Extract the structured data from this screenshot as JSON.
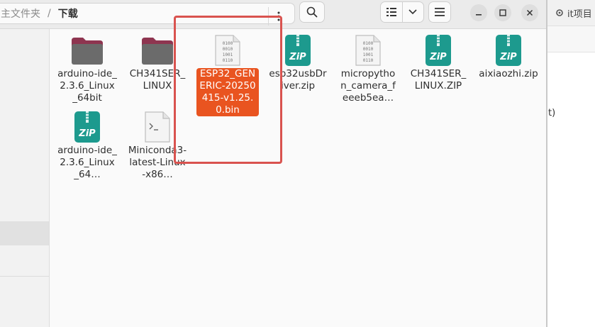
{
  "header": {
    "breadcrumb_parent": "主文件夹",
    "breadcrumb_separator": "/",
    "breadcrumb_current": "下载"
  },
  "files": [
    {
      "name": "arduino-ide_2.3.6_Linux_64bit",
      "label": "arduino-ide_2.3.6_Linux_64bit",
      "type": "folder",
      "icon": "folder-icon"
    },
    {
      "name": "CH341SER_LINUX",
      "label": "CH341SER_LINUX",
      "type": "folder",
      "icon": "folder-icon"
    },
    {
      "name": "ESP32_GENERIC-20250415-v1.25.0.bin",
      "label": "ESP32_GENERIC-20250415-v1.25.0.bin",
      "type": "binary",
      "icon": "binary-file-icon",
      "selected": true
    },
    {
      "name": "esp32usbDriver.zip",
      "label": "esp32usbDriver.zip",
      "type": "zip",
      "icon": "zip-archive-icon"
    },
    {
      "name": "micropython_camera_feeeb5ea…",
      "label": "micropython_camera_feeeb5ea…",
      "type": "binary",
      "icon": "binary-file-icon"
    },
    {
      "name": "CH341SER_LINUX.ZIP",
      "label": "CH341SER_LINUX.ZIP",
      "type": "zip",
      "icon": "zip-archive-icon"
    },
    {
      "name": "aixiaozhi.zip",
      "label": "aixiaozhi.zip",
      "type": "zip",
      "icon": "zip-archive-icon"
    },
    {
      "name": "arduino-ide_2.3.6_Linux_64…",
      "label": "arduino-ide_2.3.6_Linux_64…",
      "type": "zip",
      "icon": "zip-archive-icon"
    },
    {
      "name": "Miniconda3-latest-Linux-x86…",
      "label": "Miniconda3-latest-Linux-x86…",
      "type": "script",
      "icon": "script-file-icon"
    }
  ],
  "background_window": {
    "tab_title": "it项目",
    "partial_text": "t)"
  },
  "colors": {
    "selection": "#e95420",
    "folder_top": "#8e3550",
    "folder_body": "#6b6b6b",
    "zip_teal": "#1d9a8e",
    "highlight_box": "#d9534f"
  }
}
